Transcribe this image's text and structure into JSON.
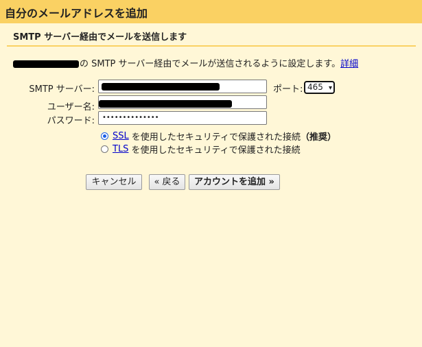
{
  "window": {
    "title": "自分のメールアドレスを追加"
  },
  "section": {
    "subtitle": "SMTP サーバー経由でメールを送信します"
  },
  "intro": {
    "text": "の SMTP サーバー経由でメールが送信されるように設定します。",
    "link": "詳細"
  },
  "form": {
    "smtp_label": "SMTP サーバー:",
    "username_label": "ユーザー名:",
    "password_label": "パスワード:",
    "password_value": "••••••••••••••",
    "port_label": "ポート:",
    "port_value": "465"
  },
  "security": {
    "ssl_link": "SSL",
    "ssl_text": "を使用したセキュリティで保護された接続",
    "ssl_recommended": "（推奨）",
    "tls_link": "TLS",
    "tls_text": "を使用したセキュリティで保護された接続",
    "selected": "SSL"
  },
  "buttons": {
    "cancel": "キャンセル",
    "back": "« 戻る",
    "add_account": "アカウントを追加 »"
  },
  "colors": {
    "title_bar": "#fad163",
    "background": "#fff7d7",
    "link": "#0000cc"
  }
}
